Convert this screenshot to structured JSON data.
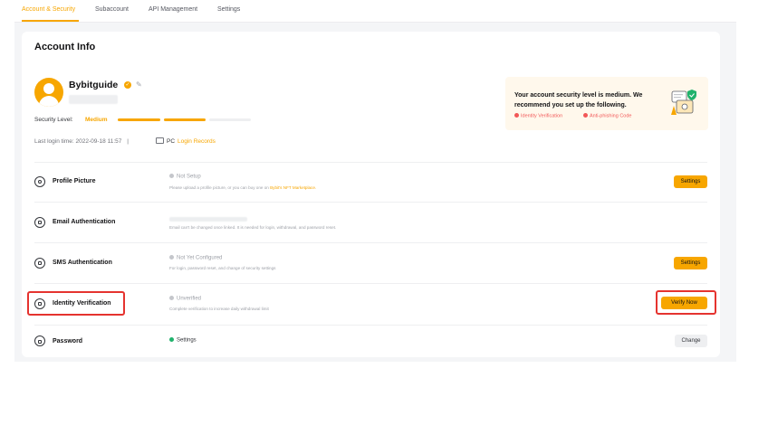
{
  "tabs": [
    "Account & Security",
    "Subaccount",
    "API Management",
    "Settings"
  ],
  "active_tab": "Account & Security",
  "account_info": {
    "title": "Account Info",
    "username": "Bybitguide",
    "security_level_label": "Security Level:",
    "security_level_value": "Medium",
    "security_level_filled": 2,
    "security_level_total": 3,
    "last_login_label": "Last login time:",
    "last_login_time": "2022-09-18 11:57",
    "separator": "|",
    "device": "PC",
    "login_records_link": "Login Records"
  },
  "security_notice": {
    "text": "Your account security level is medium. We recommend you set up the following.",
    "items": [
      "Identity Verification",
      "Anti-phishing Code"
    ]
  },
  "rows": [
    {
      "title": "Profile Picture",
      "icon": "profile-picture-icon",
      "status": "Not Setup",
      "desc": "Please upload a profile picture, or you can buy one on ",
      "desc_link": "Bybit's NFT Marketplace.",
      "button": "Settings"
    },
    {
      "title": "Email Authentication",
      "icon": "email-icon",
      "desc": "Email can't be changed once linked. It is needed for login, withdrawal, and password reset."
    },
    {
      "title": "SMS Authentication",
      "icon": "sms-icon",
      "status": "Not Yet Configured",
      "desc": "For login, password reset, and change of security settings",
      "button": "Settings"
    },
    {
      "title": "Identity Verification",
      "icon": "identity-icon",
      "status": "Unverified",
      "desc": "Complete verification to increase daily withdrawal limit",
      "button": "Verify Now"
    },
    {
      "title": "Password",
      "icon": "lock-icon",
      "status": "Settings",
      "button": "Change"
    }
  ],
  "colors": {
    "accent": "#f7a600",
    "alert": "#f25757",
    "success": "#20b26c",
    "highlight": "#e5332f"
  }
}
